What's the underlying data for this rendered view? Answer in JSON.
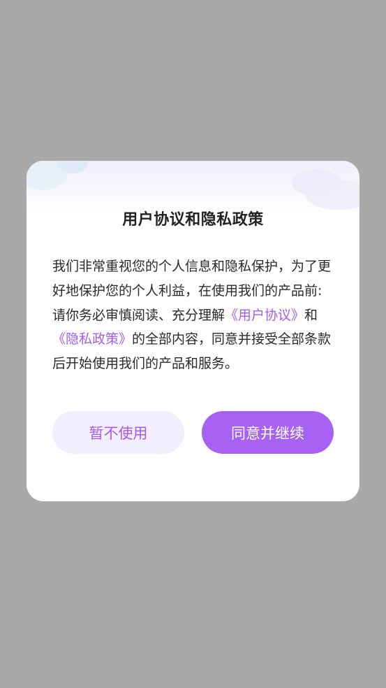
{
  "dialog": {
    "title": "用户协议和隐私政策",
    "intro": "我们非常重视您的个人信息和隐私保护，为了更好地保护您的个人利益，在使用我们的产品前:",
    "body_prefix": "请你务必审慎阅读、充分理解",
    "user_agreement_link": "《用户协议》",
    "conjunction": "和",
    "privacy_policy_link": "《隐私政策》",
    "body_suffix": "的全部内容，同意并接受全部条款后开始使用我们的产品和服务。",
    "decline_label": "暂不使用",
    "agree_label": "同意并继续"
  },
  "colors": {
    "overlay": "#a9a9a9",
    "accent": "#a761f3",
    "link": "#a45cf0",
    "decline_bg": "#f3eefd"
  }
}
